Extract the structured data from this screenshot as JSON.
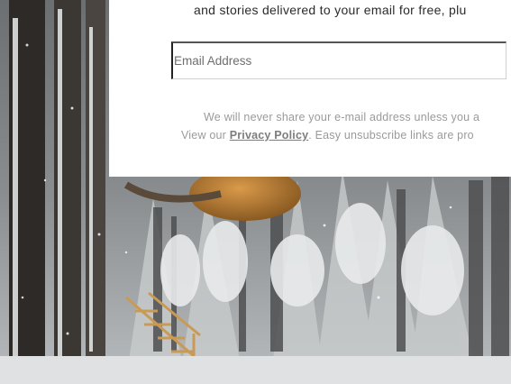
{
  "signup": {
    "intro_text": "and stories delivered to your email for free, plu",
    "email_placeholder": "Email Address",
    "privacy_line1": "We will never share your e-mail address unless you a",
    "privacy_line2_prefix": "View our ",
    "privacy_link": "Privacy Policy",
    "privacy_line2_suffix": ". Easy unsubscribe links are pro"
  },
  "background": {
    "description_icon": "snowy-forest-treehouse-photo"
  }
}
